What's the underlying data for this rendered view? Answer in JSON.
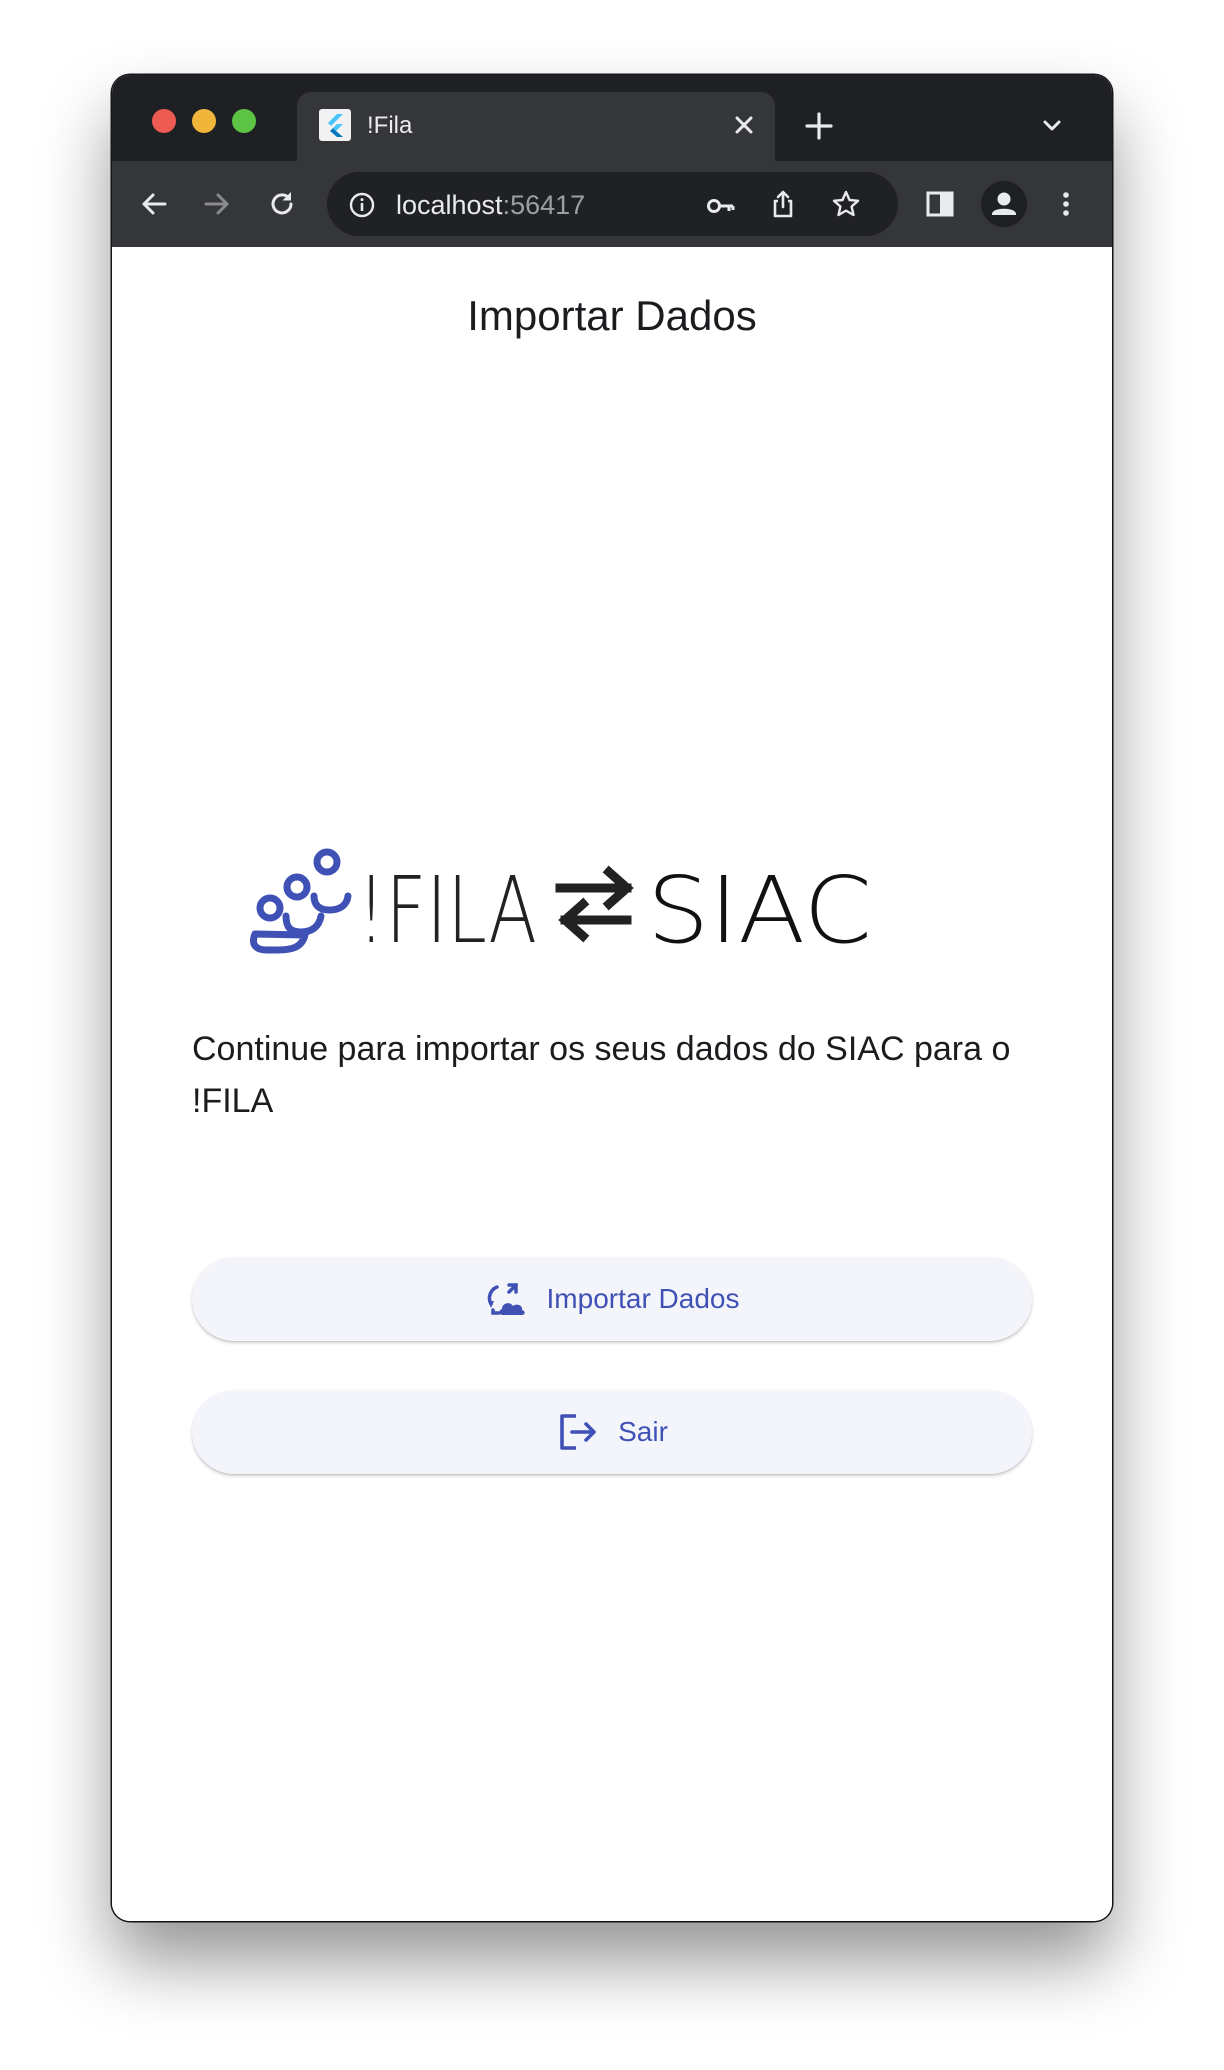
{
  "browser": {
    "tab_title": "!Fila",
    "url_host": "localhost",
    "url_port": ":56417",
    "icons": [
      "back-arrow-icon",
      "forward-arrow-icon",
      "reload-icon",
      "info-icon",
      "key-icon",
      "share-icon",
      "star-icon",
      "side-panel-icon",
      "profile-icon",
      "more-vert-icon",
      "close-icon",
      "plus-icon",
      "chevron-down-icon"
    ]
  },
  "page": {
    "title": "Importar Dados",
    "logo": {
      "left_text": "!FILA",
      "right_text": "SIAC",
      "arrows_icon": "swap-arrows-icon",
      "people_icon": "people-group-icon",
      "accent_color": "#3f51b5"
    },
    "description": "Continue para importar os seus dados do SIAC para o !FILA",
    "buttons": {
      "import_label": "Importar Dados",
      "import_icon": "cloud-sync-icon",
      "exit_label": "Sair",
      "exit_icon": "logout-icon"
    }
  },
  "colors": {
    "primary": "#3f51b5",
    "button_bg": "#f4f5fb",
    "chrome_dark": "#35363a"
  }
}
